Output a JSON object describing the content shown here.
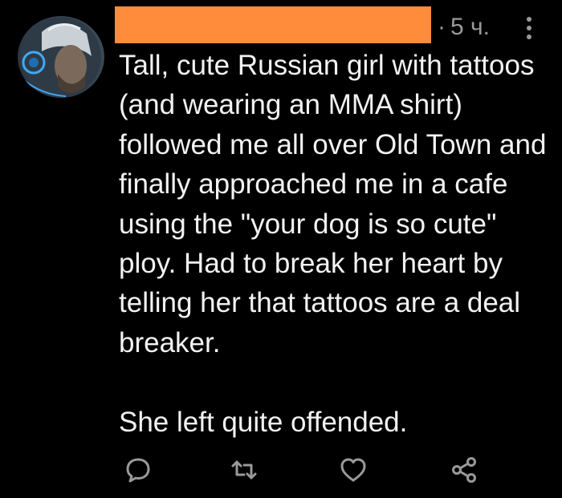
{
  "post": {
    "timestamp": "5 ч.",
    "separator": "·",
    "body": "Tall, cute Russian girl with tattoos (and wearing an MMA shirt) followed me all over Old Town and finally approached me in a cafe using the \"your dog is so cute\" ploy. Had to break her heart by telling her that tattoos are a deal breaker.\n\nShe left quite offended."
  },
  "colors": {
    "background": "#000000",
    "redaction": "#ff8c3a",
    "meta_text": "#9a9a9a",
    "body_text": "#f2f2f2",
    "icon": "#9a9a9a"
  },
  "icons": {
    "more": "more-vertical-icon",
    "reply": "reply-bubble-icon",
    "repost": "repost-icon",
    "like": "heart-icon",
    "share": "share-icon"
  }
}
